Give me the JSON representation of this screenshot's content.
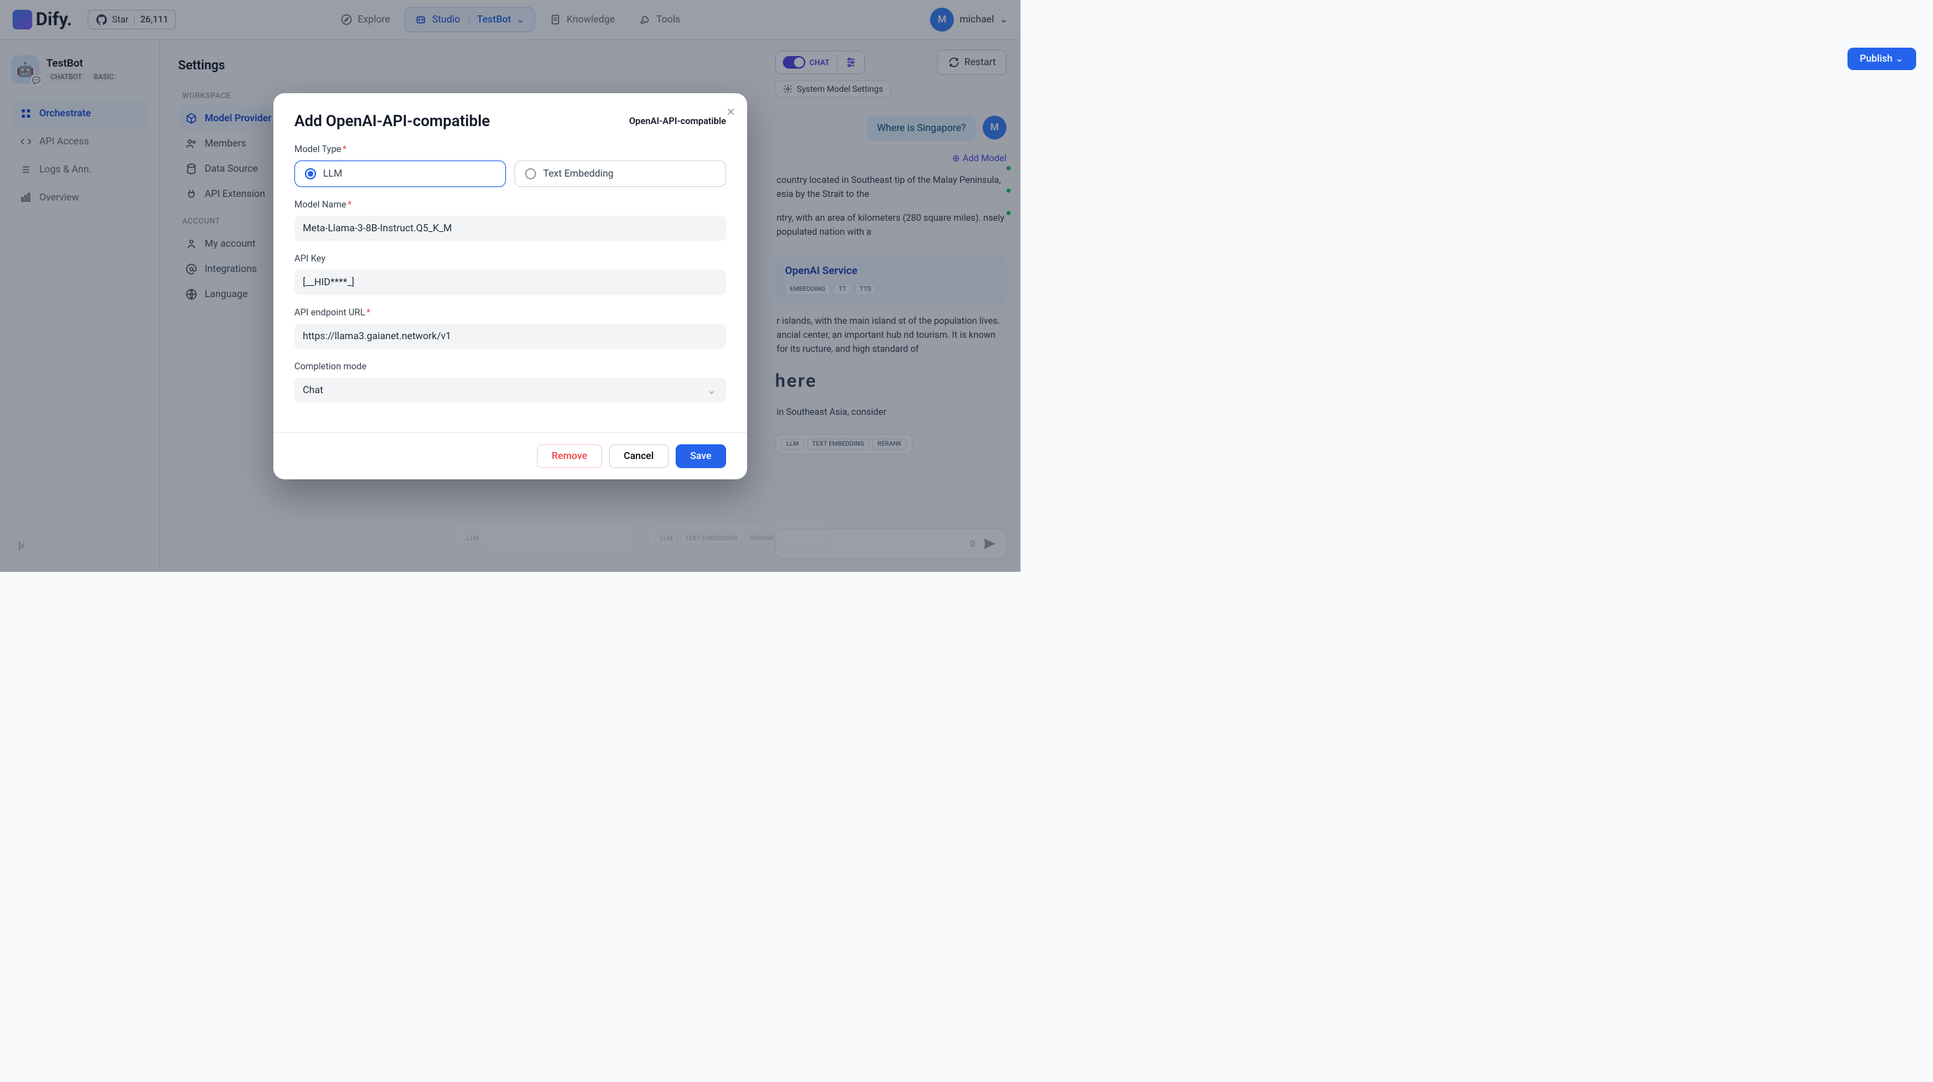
{
  "topbar": {
    "logo": "Dify.",
    "star_label": "Star",
    "star_count": "26,111",
    "nav": {
      "explore": "Explore",
      "studio": "Studio",
      "studio_sub": "TestBot",
      "knowledge": "Knowledge",
      "tools": "Tools"
    },
    "user": {
      "name": "michael",
      "initial": "M"
    }
  },
  "app": {
    "name": "TestBot",
    "badges": [
      "CHATBOT",
      "BASIC"
    ],
    "nav": {
      "orchestrate": "Orchestrate",
      "api_access": "API Access",
      "logs": "Logs & Ann.",
      "overview": "Overview"
    }
  },
  "settings": {
    "title": "Settings",
    "section_workspace": "WORKSPACE",
    "section_account": "ACCOUNT",
    "items": {
      "model_provider": "Model Provider",
      "members": "Members",
      "data_source": "Data Source",
      "api_extension": "API Extension",
      "my_account": "My account",
      "integrations": "Integrations",
      "language": "Language"
    }
  },
  "right": {
    "chat_mode_label": "CHAT",
    "restart": "Restart",
    "publish": "Publish",
    "sys_model": "System Model Settings",
    "question": "Where is Singapore?",
    "add_model": "Add Model",
    "model_in_blue": "OpenAI Service",
    "blue_tags": [
      "EMBEDDING",
      "TT",
      "TTS"
    ],
    "response_1": "country located in Southeast tip of the Malay Peninsula, esia by the Strait to the",
    "response_2": "ntry, with an area of kilometers (280 square miles). nsely populated nation with a",
    "response_3": "r islands, with the main island st of the population lives. ancial center, an important hub nd tourism. It is known for its ructure, and high standard of",
    "response_4": "in Southeast Asia, consider",
    "provider_name": "here",
    "tag_groups": [
      [
        "LLM"
      ],
      [
        "LLM",
        "TEXT EMBEDDING",
        "RERANK"
      ],
      [
        "LLM",
        "TEXT EMBEDDING",
        "RERANK"
      ]
    ],
    "input_count": "0"
  },
  "modal": {
    "title": "Add OpenAI-API-compatible",
    "subtitle": "OpenAI-API-compatible",
    "labels": {
      "model_type": "Model Type",
      "model_name": "Model Name",
      "api_key": "API Key",
      "api_endpoint": "API endpoint URL",
      "completion_mode": "Completion mode"
    },
    "radio": {
      "llm": "LLM",
      "text_embedding": "Text Embedding"
    },
    "values": {
      "model_name": "Meta-Llama-3-8B-Instruct.Q5_K_M",
      "api_key": "[__HID****_]",
      "api_endpoint": "https://llama3.gaianet.network/v1",
      "completion_mode": "Chat"
    },
    "buttons": {
      "remove": "Remove",
      "cancel": "Cancel",
      "save": "Save"
    }
  }
}
